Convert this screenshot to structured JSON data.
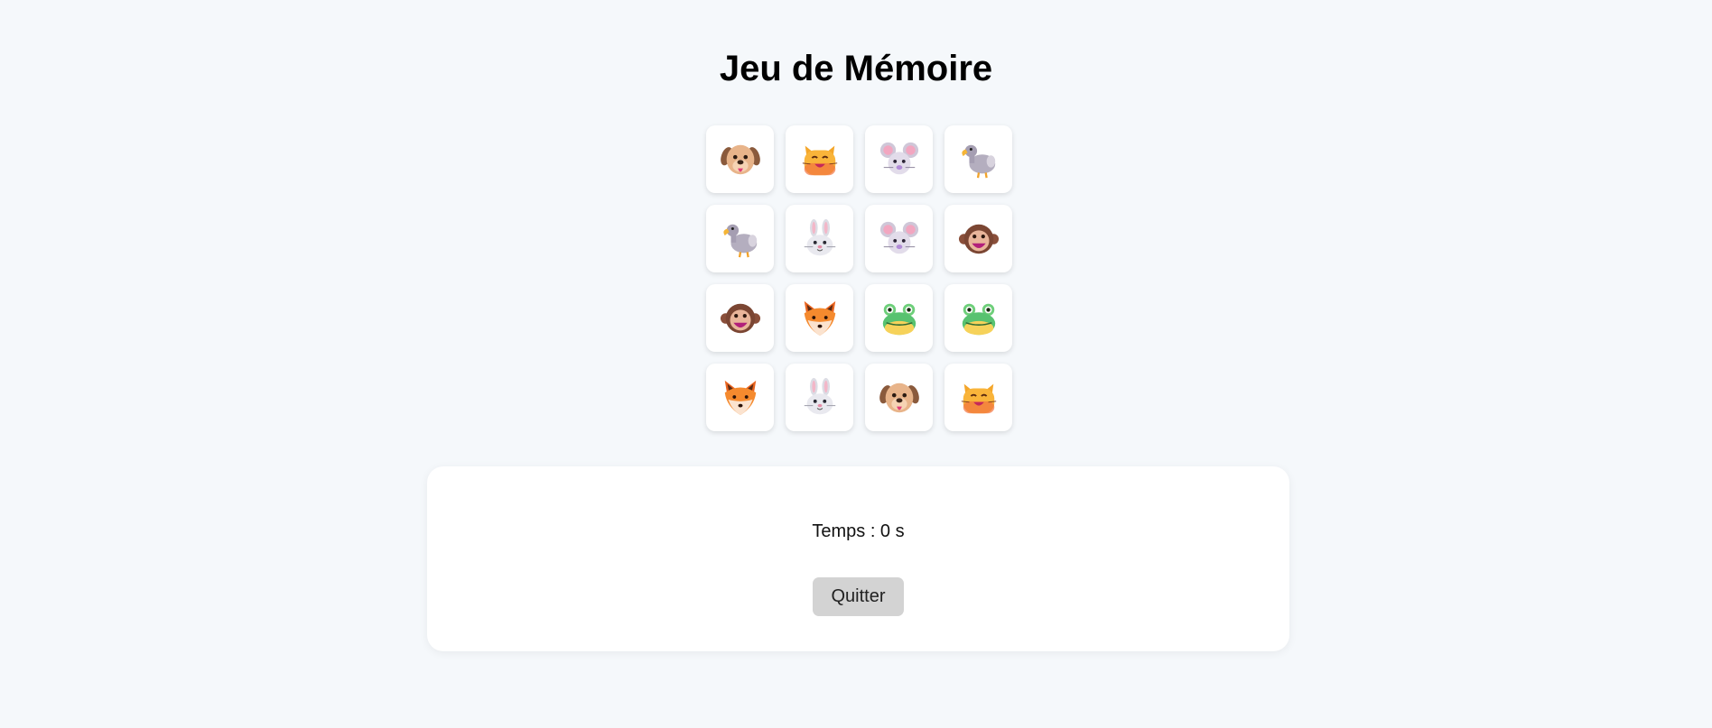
{
  "game": {
    "title": "Jeu de Mémoire",
    "cards": [
      {
        "icon": "dog-face-icon"
      },
      {
        "icon": "cat-face-icon"
      },
      {
        "icon": "mouse-face-icon"
      },
      {
        "icon": "dodo-icon"
      },
      {
        "icon": "dodo-icon"
      },
      {
        "icon": "rabbit-face-icon"
      },
      {
        "icon": "mouse-face-icon"
      },
      {
        "icon": "monkey-face-icon"
      },
      {
        "icon": "monkey-face-icon"
      },
      {
        "icon": "fox-face-icon"
      },
      {
        "icon": "frog-face-icon"
      },
      {
        "icon": "frog-face-icon"
      },
      {
        "icon": "fox-face-icon"
      },
      {
        "icon": "rabbit-face-icon"
      },
      {
        "icon": "dog-face-icon"
      },
      {
        "icon": "cat-face-icon"
      }
    ]
  },
  "status": {
    "timer_text": "Temps : 0 s",
    "quit_label": "Quitter"
  }
}
